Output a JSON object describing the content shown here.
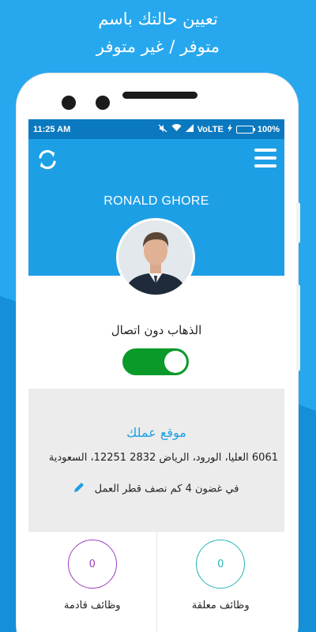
{
  "promo": {
    "line1": "تعيين حالتك باسم",
    "line2": "متوفر / غير متوفر"
  },
  "statusbar": {
    "time": "11:25 AM",
    "network": "VoLTE",
    "battery": "100%"
  },
  "header": {
    "user_name": "RONALD GHORE",
    "refresh_icon": "refresh-icon",
    "menu_icon": "hamburger-menu-icon"
  },
  "offline": {
    "label": "الذهاب دون اتصال",
    "toggle_on": true
  },
  "work": {
    "title": "موقع عملك",
    "address": "6061 العليا، الورود، الرياض 2832 12251، السعودية",
    "radius": "في غضون 4 كم نصف قطر العمل"
  },
  "jobs": [
    {
      "count": "0",
      "label": "وظائف قادمة"
    },
    {
      "count": "0",
      "label": "وظائف معلقة"
    }
  ],
  "colors": {
    "primary": "#1d9fe6",
    "statusbar": "#0b79c0",
    "toggle": "#0a9a2a",
    "upcoming": "#9b3fbd",
    "pending": "#27b5b5"
  }
}
